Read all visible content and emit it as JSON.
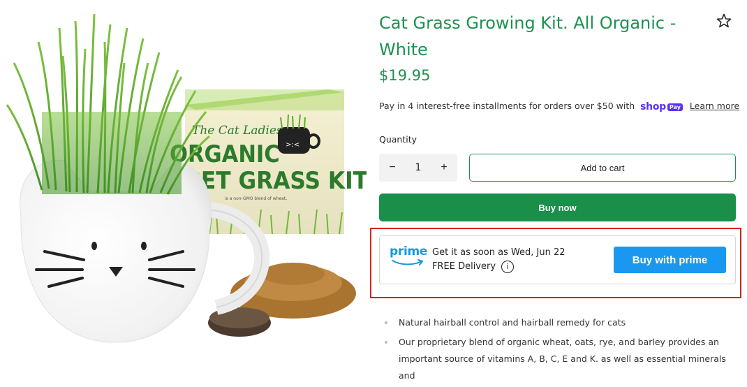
{
  "product": {
    "title": "Cat Grass Growing Kit. All Organic - White",
    "price": "$19.95",
    "installments_text": "Pay in 4 interest-free installments for orders over $50 with",
    "shop_word": "shop",
    "pay_word": "Pay",
    "learn_more": "Learn more"
  },
  "image": {
    "box_brand": "The Cat Ladies",
    "box_line1": "ORGANIC",
    "box_line2": "PET GRASS KIT",
    "box_small": "is a non-GMO blend of wheat,"
  },
  "purchase": {
    "quantity_label": "Quantity",
    "minus": "−",
    "quantity": 1,
    "plus": "+",
    "add_to_cart": "Add to cart",
    "buy_now": "Buy now"
  },
  "prime": {
    "logo": "prime",
    "delivery_line": "Get it as soon as Wed, Jun 22",
    "free_delivery": "FREE Delivery",
    "info_symbol": "i",
    "button": "Buy with prime"
  },
  "features": [
    "Natural hairball control and hairball remedy for cats",
    "Our proprietary blend of organic wheat, oats, rye, and barley provides an important source of vitamins A, B, C, E and K. as well as essential minerals and"
  ],
  "colors": {
    "brand_green": "#1e9150",
    "buy_now_bg": "#1a8f4a",
    "prime_blue": "#1a98f0",
    "highlight_red": "#d92020",
    "shop_purple": "#5a31f4"
  },
  "icons": [
    "star-outline-icon",
    "info-circle-icon",
    "prime-smile-arrow-icon"
  ]
}
